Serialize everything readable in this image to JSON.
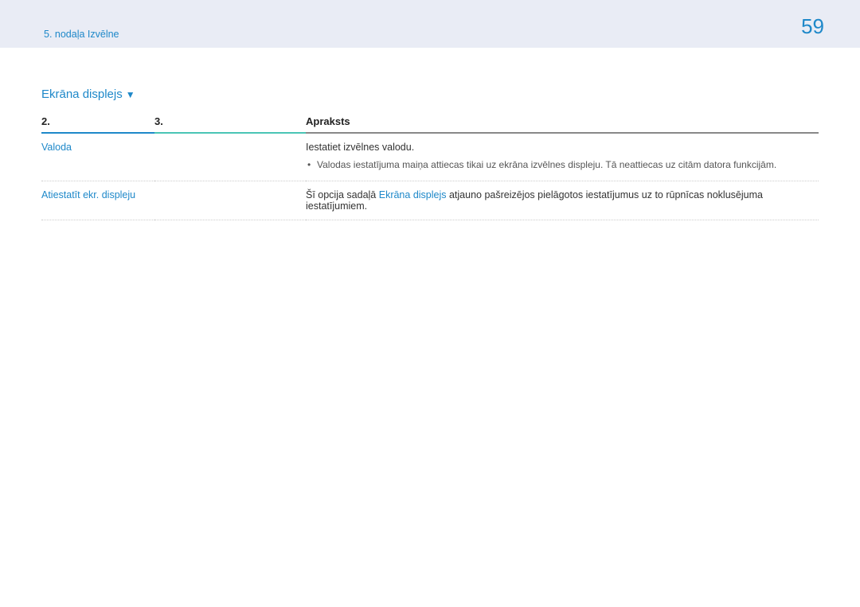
{
  "header": {
    "breadcrumb": "5. nodaļa Izvēlne",
    "page_number": "59"
  },
  "section": {
    "title": "Ekrāna displejs",
    "arrow": "▼"
  },
  "table": {
    "headers": {
      "col1": "2.",
      "col2": "3.",
      "col3": "Apraksts"
    },
    "rows": [
      {
        "name": "Valoda",
        "desc_main": "Iestatiet izvēlnes valodu.",
        "bullet": "Valodas iestatījuma maiņa attiecas tikai uz ekrāna izvēlnes displeju. Tā neattiecas uz citām datora funkcijām."
      },
      {
        "name": "Atiestatīt ekr. displeju",
        "desc_pre": "Šī opcija sadaļā ",
        "desc_link": "Ekrāna displejs",
        "desc_post": " atjauno pašreizējos pielāgotos iestatījumus uz to rūpnīcas noklusējuma iestatījumiem."
      }
    ]
  }
}
